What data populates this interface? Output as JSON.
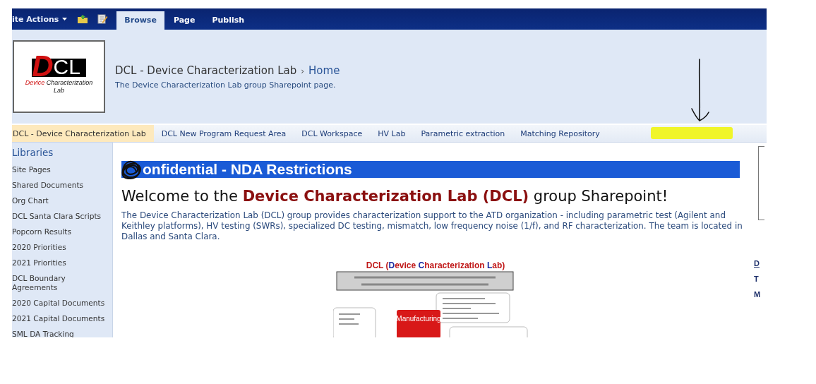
{
  "ribbon": {
    "site_actions": "ite Actions",
    "tabs": [
      {
        "label": "Browse",
        "selected": true
      },
      {
        "label": "Page",
        "selected": false
      },
      {
        "label": "Publish",
        "selected": false
      }
    ]
  },
  "header": {
    "logo": {
      "mark_first": "D",
      "mark_rest": "CL",
      "caption_first": "Device",
      "caption_rest": "Characterization Lab"
    },
    "breadcrumb": {
      "site": "DCL - Device Characterization Lab",
      "separator": "›",
      "page": "Home"
    },
    "description": "The Device Characterization Lab group Sharepoint page."
  },
  "top_nav": [
    {
      "label": "DCL - Device Characterization Lab",
      "selected": true
    },
    {
      "label": "DCL New Program Request Area",
      "selected": false
    },
    {
      "label": "DCL Workspace",
      "selected": false
    },
    {
      "label": "HV Lab",
      "selected": false
    },
    {
      "label": "Parametric extraction",
      "selected": false
    },
    {
      "label": "Matching Repository",
      "selected": false
    }
  ],
  "sidebar": {
    "heading": "Libraries",
    "items": [
      "Site Pages",
      "Shared Documents",
      "Org Chart",
      "DCL Santa Clara Scripts",
      "Popcorn Results",
      "2020 Priorities",
      "2021 Priorities",
      "DCL Boundary Agreements",
      "2020 Capital Documents",
      "2021 Capital Documents",
      "SML DA Tracking"
    ]
  },
  "content": {
    "banner": "onfidential - NDA Restrictions",
    "welcome": "Welcome to the **Device Characterization Lab (DCL)** group Sharepoint!",
    "intro": "The Device Characterization Lab (DCL) group provides characterization support to the ATD organization - including parametric test (Agilent and Keithley platforms), HV testing (SWRs), specialized DC testing, mismatch, low frequency noise (1/f), and RF characterization.  The team is located in Dallas and Santa Clara.",
    "diagram": {
      "title": [
        {
          "text": "DCL (",
          "kind": "plain"
        },
        {
          "text": "D",
          "kind": "accent"
        },
        {
          "text": "evice ",
          "kind": "plain"
        },
        {
          "text": "C",
          "kind": "accent"
        },
        {
          "text": "haracterization ",
          "kind": "plain"
        },
        {
          "text": "L",
          "kind": "accent"
        },
        {
          "text": "ab)",
          "kind": "plain"
        }
      ],
      "callout": "Manufacturing"
    },
    "right_column": [
      {
        "text": "D",
        "kind": "link"
      },
      {
        "text": "T",
        "kind": "plain"
      },
      {
        "text": "M",
        "kind": "plain"
      }
    ]
  }
}
